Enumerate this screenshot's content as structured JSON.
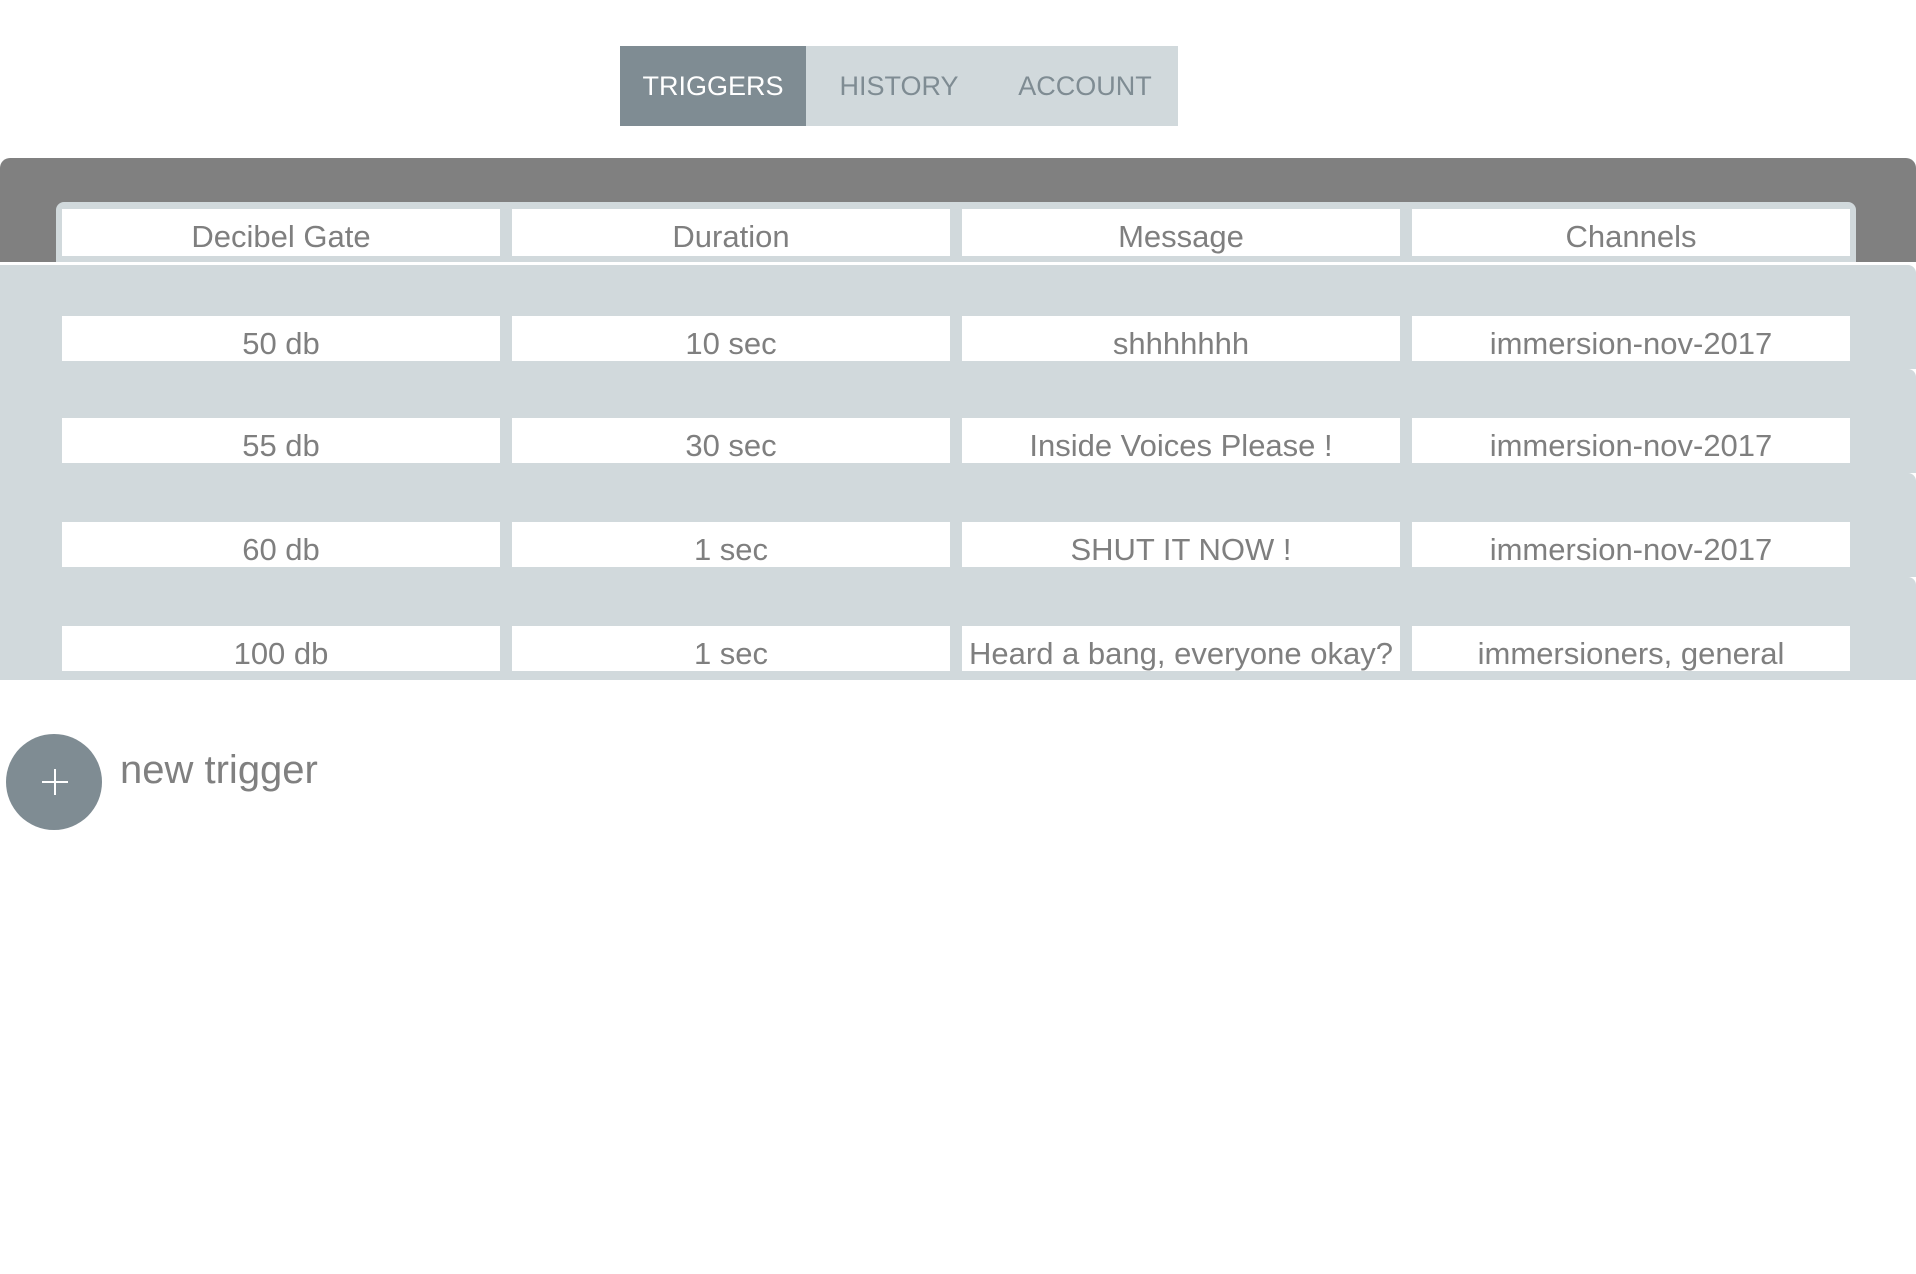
{
  "tabs": [
    {
      "label": "TRIGGERS",
      "active": true
    },
    {
      "label": "HISTORY",
      "active": false
    },
    {
      "label": "ACCOUNT",
      "active": false
    }
  ],
  "table": {
    "headers": [
      "Decibel Gate",
      "Duration",
      "Message",
      "Channels"
    ],
    "rows": [
      [
        "50 db",
        "10 sec",
        "shhhhhhh",
        "immersion-nov-2017"
      ],
      [
        "55 db",
        "30 sec",
        "Inside Voices Please !",
        "immersion-nov-2017"
      ],
      [
        "60 db",
        "1 sec",
        "SHUT IT NOW !",
        "immersion-nov-2017"
      ],
      [
        "100 db",
        "1 sec",
        "Heard a bang, everyone okay?",
        "immersioners, general"
      ]
    ]
  },
  "new_trigger": {
    "icon": "plus-icon",
    "label": "new trigger"
  },
  "colors": {
    "accent": "#7f8c93",
    "light_band": "#d1d9dc",
    "header_band": "#808080",
    "cell_text": "#7f7f7f"
  }
}
